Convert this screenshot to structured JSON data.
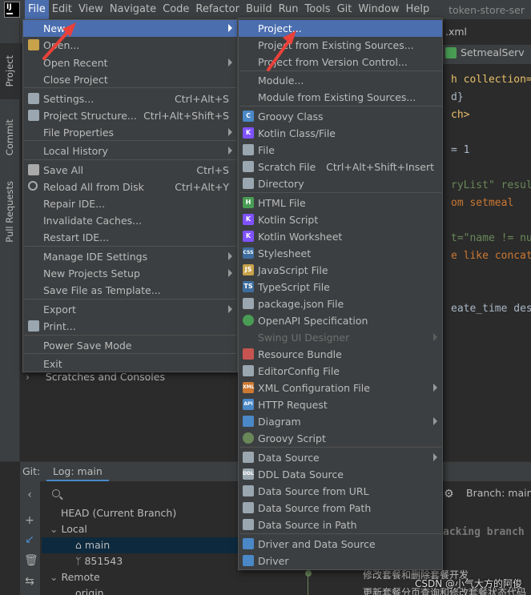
{
  "menubar": {
    "items": [
      "File",
      "Edit",
      "View",
      "Navigate",
      "Code",
      "Refactor",
      "Build",
      "Run",
      "Tools",
      "Git",
      "Window",
      "Help"
    ],
    "project_title": "token-store-ser"
  },
  "tool_strip": {
    "project": "Project",
    "commit": "Commit",
    "pull_requests": "Pull Requests"
  },
  "project_header": "tok",
  "editor": {
    "tab_partial": ".xml",
    "tab2": "SetmealServ",
    "lines": [
      "h collection=\"",
      "d}",
      "ch>",
      "= 1",
      "ryList\" result",
      "om setmeal",
      "t=\"name != nul",
      "e like concat(",
      "eate_time desc"
    ]
  },
  "file_menu": {
    "items": [
      {
        "label": "New",
        "shortcut": "",
        "submenu": true
      },
      {
        "label": "Open...",
        "shortcut": "",
        "submenu": false
      },
      {
        "label": "Open Recent",
        "shortcut": "",
        "submenu": true
      },
      {
        "label": "Close Project",
        "shortcut": "",
        "submenu": false
      },
      {
        "label": "Settings...",
        "shortcut": "Ctrl+Alt+S",
        "submenu": false
      },
      {
        "label": "Project Structure...",
        "shortcut": "Ctrl+Alt+Shift+S",
        "submenu": false
      },
      {
        "label": "File Properties",
        "shortcut": "",
        "submenu": true
      },
      {
        "label": "Local History",
        "shortcut": "",
        "submenu": true
      },
      {
        "label": "Save All",
        "shortcut": "Ctrl+S",
        "submenu": false
      },
      {
        "label": "Reload All from Disk",
        "shortcut": "Ctrl+Alt+Y",
        "submenu": false
      },
      {
        "label": "Repair IDE...",
        "shortcut": "",
        "submenu": false
      },
      {
        "label": "Invalidate Caches...",
        "shortcut": "",
        "submenu": false
      },
      {
        "label": "Restart IDE...",
        "shortcut": "",
        "submenu": false
      },
      {
        "label": "Manage IDE Settings",
        "shortcut": "",
        "submenu": true
      },
      {
        "label": "New Projects Setup",
        "shortcut": "",
        "submenu": true
      },
      {
        "label": "Save File as Template...",
        "shortcut": "",
        "submenu": false
      },
      {
        "label": "Export",
        "shortcut": "",
        "submenu": true
      },
      {
        "label": "Print...",
        "shortcut": "",
        "submenu": false
      },
      {
        "label": "Power Save Mode",
        "shortcut": "",
        "submenu": false
      },
      {
        "label": "Exit",
        "shortcut": "",
        "submenu": false
      }
    ]
  },
  "new_menu": {
    "items": [
      {
        "label": "Project...",
        "shortcut": "",
        "submenu": false,
        "icon": "none"
      },
      {
        "label": "Project from Existing Sources...",
        "shortcut": "",
        "submenu": false,
        "icon": "none"
      },
      {
        "label": "Project from Version Control...",
        "shortcut": "",
        "submenu": false,
        "icon": "none"
      },
      {
        "label": "Module...",
        "shortcut": "",
        "submenu": false,
        "icon": "none"
      },
      {
        "label": "Module from Existing Sources...",
        "shortcut": "",
        "submenu": false,
        "icon": "none"
      },
      {
        "label": "Groovy Class",
        "shortcut": "",
        "submenu": false,
        "icon": "groovy-class-icon"
      },
      {
        "label": "Kotlin Class/File",
        "shortcut": "",
        "submenu": false,
        "icon": "kotlin-file-icon"
      },
      {
        "label": "File",
        "shortcut": "",
        "submenu": false,
        "icon": "file-icon"
      },
      {
        "label": "Scratch File",
        "shortcut": "Ctrl+Alt+Shift+Insert",
        "submenu": false,
        "icon": "scratch-file-icon"
      },
      {
        "label": "Directory",
        "shortcut": "",
        "submenu": false,
        "icon": "folder-icon"
      },
      {
        "label": "HTML File",
        "shortcut": "",
        "submenu": false,
        "icon": "html-file-icon"
      },
      {
        "label": "Kotlin Script",
        "shortcut": "",
        "submenu": false,
        "icon": "kotlin-script-icon"
      },
      {
        "label": "Kotlin Worksheet",
        "shortcut": "",
        "submenu": false,
        "icon": "kotlin-worksheet-icon"
      },
      {
        "label": "Stylesheet",
        "shortcut": "",
        "submenu": false,
        "icon": "css-file-icon"
      },
      {
        "label": "JavaScript File",
        "shortcut": "",
        "submenu": false,
        "icon": "js-file-icon"
      },
      {
        "label": "TypeScript File",
        "shortcut": "",
        "submenu": false,
        "icon": "ts-file-icon"
      },
      {
        "label": "package.json File",
        "shortcut": "",
        "submenu": false,
        "icon": "npm-icon"
      },
      {
        "label": "OpenAPI Specification",
        "shortcut": "",
        "submenu": false,
        "icon": "openapi-icon"
      },
      {
        "label": "Swing UI Designer",
        "shortcut": "",
        "submenu": true,
        "icon": "none",
        "disabled": true
      },
      {
        "label": "Resource Bundle",
        "shortcut": "",
        "submenu": false,
        "icon": "resource-bundle-icon"
      },
      {
        "label": "EditorConfig File",
        "shortcut": "",
        "submenu": false,
        "icon": "gear-icon"
      },
      {
        "label": "XML Configuration File",
        "shortcut": "",
        "submenu": true,
        "icon": "xml-file-icon"
      },
      {
        "label": "HTTP Request",
        "shortcut": "",
        "submenu": false,
        "icon": "api-icon"
      },
      {
        "label": "Diagram",
        "shortcut": "",
        "submenu": true,
        "icon": "diagram-icon"
      },
      {
        "label": "Groovy Script",
        "shortcut": "",
        "submenu": false,
        "icon": "groovy-script-icon"
      },
      {
        "label": "Data Source",
        "shortcut": "",
        "submenu": true,
        "icon": "database-icon"
      },
      {
        "label": "DDL Data Source",
        "shortcut": "",
        "submenu": false,
        "icon": "ddl-icon"
      },
      {
        "label": "Data Source from URL",
        "shortcut": "",
        "submenu": false,
        "icon": "database-url-icon"
      },
      {
        "label": "Data Source from Path",
        "shortcut": "",
        "submenu": false,
        "icon": "database-path-icon"
      },
      {
        "label": "Data Source in Path",
        "shortcut": "",
        "submenu": false,
        "icon": "database-in-path-icon"
      },
      {
        "label": "Driver and Data Source",
        "shortcut": "",
        "submenu": false,
        "icon": "driver-ds-icon"
      },
      {
        "label": "Driver",
        "shortcut": "",
        "submenu": false,
        "icon": "driver-icon"
      }
    ]
  },
  "project_tree": {
    "scratches": "Scratches and Consoles"
  },
  "bottom": {
    "git_label": "Git:",
    "log_tab": "Log: main",
    "tree": [
      "HEAD (Current Branch)",
      "Local",
      "main",
      "851543",
      "Remote",
      "origin"
    ],
    "branch_label": "Branch: main",
    "tracking_text": "acking branch 'or",
    "commit1": "修改套餐和删除套餐开发",
    "commit2": "更新套餐分页查询和修改套餐状态代码"
  },
  "watermark": "CSDN @小气大方的阿俊",
  "colors": {
    "menu_bg": "#3c3f41",
    "highlight": "#4b6eaf",
    "annotation_arrow": "#e8413a"
  }
}
